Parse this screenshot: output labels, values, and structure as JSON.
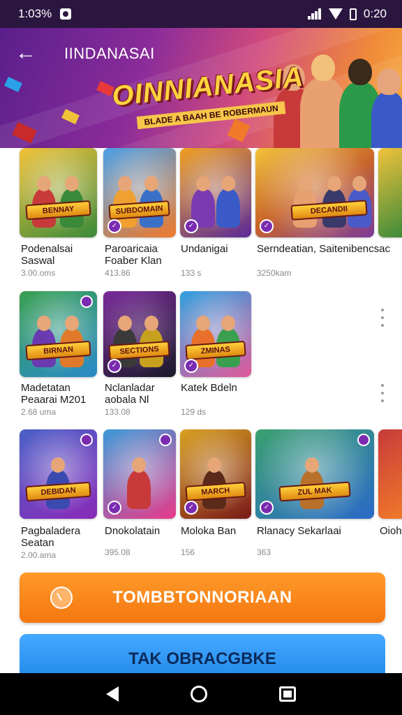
{
  "status_bar": {
    "time": "1:03%",
    "right_time": "0:20"
  },
  "header": {
    "back_label": "←",
    "app_title": "IINDANASAI"
  },
  "banner": {
    "title": "OINNIANASIA",
    "subtitle": "BLADE A BAAH BE ROBERMAUN"
  },
  "rows": [
    [
      {
        "name": "Podenalsai\nSaswal",
        "size": "3.00.oms",
        "logo": "BENNAY",
        "colors": [
          "#3a8a3a",
          "#f2c23a"
        ]
      },
      {
        "name": "Paroaricaia\nFoaber Klan",
        "size": "413.86",
        "logo": "SUBDOMAIN",
        "colors": [
          "#4aa0e8",
          "#f07a2a"
        ]
      },
      {
        "name": "Undanigai",
        "size": "133 s",
        "logo": "",
        "colors": [
          "#5a2a9a",
          "#f0a020"
        ]
      },
      {
        "name": "Serndeatian, Saitenibencsac",
        "size": "3250kam",
        "logo": "DECANDII",
        "colors": [
          "#c8642a",
          "#7a3a9a"
        ]
      }
    ],
    [
      {
        "name": "Madetatan\nPeaarai M201",
        "size": "2.68 uma",
        "logo": "BIRNAN",
        "colors": [
          "#2a8ac8",
          "#3aa050"
        ]
      },
      {
        "name": "Nclanladar\naobala Nl",
        "size": "133.08",
        "logo": "SECTIONS",
        "colors": [
          "#1a1a2a",
          "#7a2a9a"
        ]
      },
      {
        "name": "Katek Bdeln",
        "size": "129 ds",
        "logo": "ZMINAS",
        "colors": [
          "#e05a9a",
          "#30a0e0"
        ]
      }
    ],
    [
      {
        "name": "Pagbaladera\nSeatan",
        "size": "2.00.ama",
        "logo": "DEBIDAN",
        "colors": [
          "#8a2ab8",
          "#4a60c8"
        ]
      },
      {
        "name": "Dnokolatain",
        "size": "395.08",
        "logo": "",
        "colors": [
          "#e83a8a",
          "#3a9ad8"
        ]
      },
      {
        "name": "Moloka Ban",
        "size": "156",
        "logo": "MARCH",
        "colors": [
          "#7a1a1a",
          "#d8a020"
        ]
      },
      {
        "name": "Rlanacy Sekarlaai",
        "size": "363",
        "logo": "ZUL MAK",
        "colors": [
          "#2a6ac8",
          "#3aa070"
        ]
      },
      {
        "name": "Oioh",
        "size": "",
        "logo": "",
        "colors": [
          "#f07a2a",
          "#c83a3a"
        ]
      }
    ]
  ],
  "buttons": {
    "primary": "TOMBBTONNORIAAN",
    "secondary": "TAK OBRACGBKE"
  }
}
